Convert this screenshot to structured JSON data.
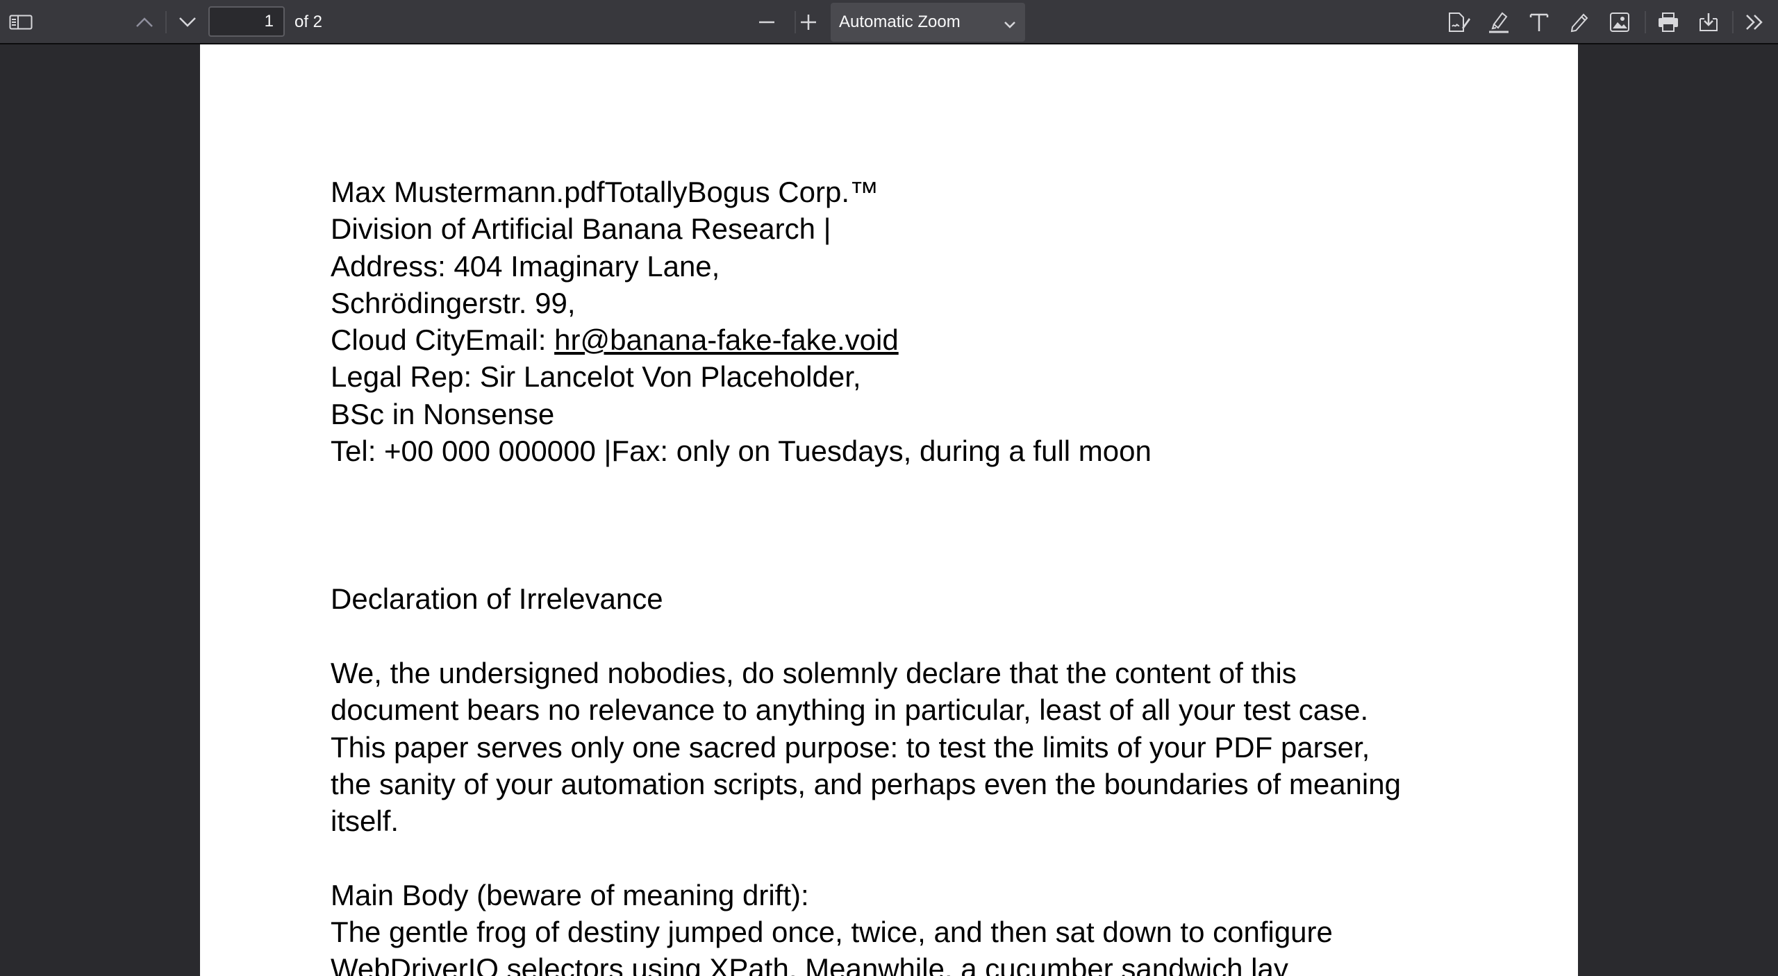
{
  "toolbar": {
    "icons": {
      "sidebar": "sidebar-toggle-icon",
      "prev": "chevron-up-icon",
      "next": "chevron-down-icon",
      "zoom_out": "minus-icon",
      "zoom_in": "plus-icon",
      "signature": "signature-icon",
      "highlight": "highlight-icon",
      "text": "text-icon",
      "draw": "pen-icon",
      "image": "image-icon",
      "print": "print-icon",
      "save": "download-icon",
      "tools": "double-chevron-right-icon"
    },
    "page_number": "1",
    "page_count": "of 2",
    "zoom": "Automatic Zoom"
  },
  "document": {
    "header": {
      "line1": "Max Mustermann.pdfTotallyBogus Corp.™",
      "line2": "Division of Artificial Banana Research |",
      "line3": "Address: 404 Imaginary Lane,",
      "line4": "Schrödingerstr. 99,",
      "line5_prefix": "Cloud CityEmail: ",
      "email": "hr@banana-fake-fake.void",
      "line6": "Legal Rep: Sir Lancelot Von Placeholder,",
      "line7": "BSc in Nonsense",
      "line8": "Tel: +00 000 000000 |Fax: only on Tuesdays, during a full moon"
    },
    "title": "Declaration of Irrelevance",
    "paragraph1": [
      "We, the undersigned nobodies, do solemnly declare that the content of this",
      "document bears no relevance to anything in particular, least of all your test case.",
      "This paper serves only one sacred purpose: to test the limits of your PDF parser,",
      "the sanity of your automation scripts, and perhaps even the boundaries of meaning",
      "itself."
    ],
    "section_heading": "Main Body (beware of meaning drift):",
    "paragraph2": [
      "The gentle frog of destiny jumped once, twice, and then sat down to configure",
      "WebDriverIO selectors using XPath. Meanwhile, a cucumber sandwich lay"
    ]
  }
}
